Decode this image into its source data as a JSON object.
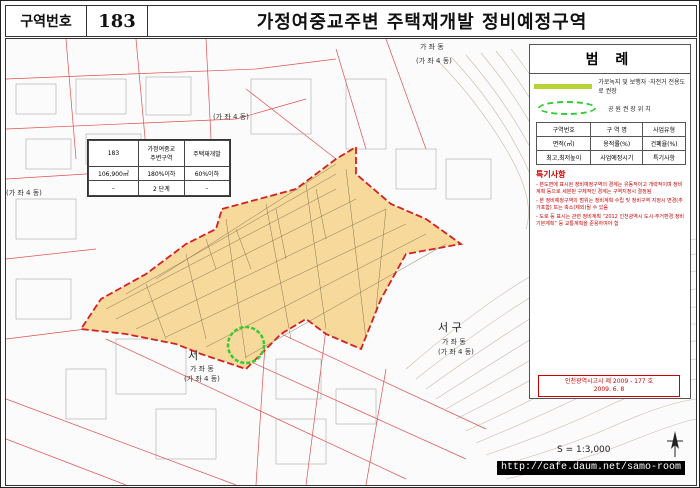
{
  "header": {
    "zone_label": "구역번호",
    "zone_number": "183",
    "title": "가정여중교주변 주택재개발 정비예정구역"
  },
  "map": {
    "place_labels": [
      "가 좌 동",
      "(가 좌 4 동)",
      "(가 좌 4 동)",
      "(가 좌 4 동)",
      "서",
      "가 좌 동",
      "(가 좌 4 동)",
      "서 구",
      "가 좌 동",
      "(가 좌 4 동)"
    ],
    "colors": {
      "zone_fill": "#f6d99b",
      "zone_border": "#d62020",
      "park_circle": "#33cc33",
      "green_road": "#b5d334"
    }
  },
  "info_table": {
    "rows": [
      [
        "183",
        "가정여중교\n주변구역",
        "주택재개발"
      ],
      [
        "106,900㎡",
        "180%이하",
        "60%이하"
      ],
      [
        "–",
        "2 단계",
        "–"
      ]
    ]
  },
  "legend": {
    "title": "범 례",
    "items": [
      {
        "symbol": "green-line",
        "label": "가로녹지 및 보행자 ·자전거 전용도로 권장"
      },
      {
        "symbol": "green-dashed-circle",
        "label": "공 원  권 장 위 치"
      }
    ],
    "table": [
      [
        "구역번호",
        "구 역 명",
        "사업유형"
      ],
      [
        "면적(㎡)",
        "용적률(%)",
        "건폐율(%)"
      ],
      [
        "최고,최저높이",
        "사업예정시기",
        "특기사항"
      ]
    ],
    "notes_title": "특기사항",
    "notes": [
      "- 본도면에 표시된 정비예정구역의 경계는 유동적이고 개략적이며 정비계획 등으로 세분된 구체적인 경계는 구역지정시 결정됨",
      "- 본 정비예정구역의 범위는 정비계획 수립 및 정비구역 지정시 변경(추가포함) 또는 축소(제외)될 수 있음",
      "- 도로 등 표시는 관련 정비계획 “2012 인천광역시 도시·주거환경 정비기본계획” 등 교통계획을 준용하여야 함"
    ]
  },
  "notice": {
    "line1": "인천광역시고시 제 2009 - 177 호",
    "line2": "2009. 6. 8"
  },
  "scale_text": "S = 1:3,000",
  "watermark": "http://cafe.daum.net/samo-room"
}
